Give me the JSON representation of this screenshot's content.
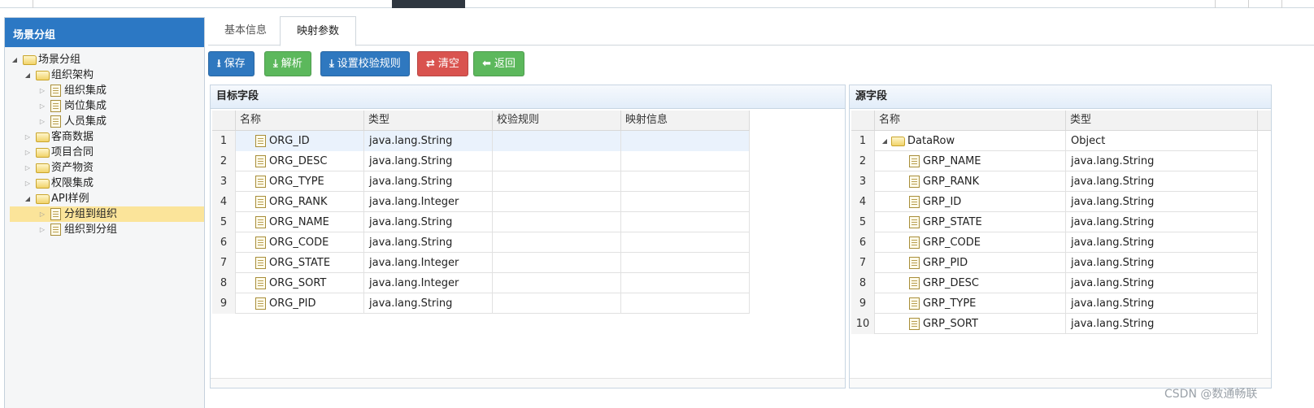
{
  "left_panel": {
    "title": "场景分组",
    "tree": [
      {
        "label": "场景分组",
        "type": "folder",
        "expanded": true,
        "level": 0
      },
      {
        "label": "组织架构",
        "type": "folder",
        "expanded": true,
        "level": 1
      },
      {
        "label": "组织集成",
        "type": "file",
        "level": 2
      },
      {
        "label": "岗位集成",
        "type": "file",
        "level": 2
      },
      {
        "label": "人员集成",
        "type": "file",
        "level": 2
      },
      {
        "label": "客商数据",
        "type": "folder",
        "expanded": false,
        "level": 1
      },
      {
        "label": "项目合同",
        "type": "folder",
        "expanded": false,
        "level": 1
      },
      {
        "label": "资产物资",
        "type": "folder",
        "expanded": false,
        "level": 1
      },
      {
        "label": "权限集成",
        "type": "folder",
        "expanded": false,
        "level": 1
      },
      {
        "label": "API样例",
        "type": "folder",
        "expanded": true,
        "level": 1
      },
      {
        "label": "分组到组织",
        "type": "file",
        "level": 2,
        "selected": true
      },
      {
        "label": "组织到分组",
        "type": "file",
        "level": 2
      }
    ]
  },
  "tabs": [
    {
      "label": "基本信息",
      "active": false
    },
    {
      "label": "映射参数",
      "active": true
    }
  ],
  "toolbar": {
    "buttons": [
      {
        "label": "保存",
        "icon": "download-icon",
        "color": "#2f78bf"
      },
      {
        "label": "解析",
        "icon": "parse-icon",
        "color": "#5cb85c"
      },
      {
        "label": "设置校验规则",
        "icon": "rules-icon",
        "color": "#2f78bf"
      },
      {
        "label": "清空",
        "icon": "shuffle-icon",
        "color": "#d9534f"
      },
      {
        "label": "返回",
        "icon": "arrow-left-icon",
        "color": "#5cb85c"
      }
    ]
  },
  "target": {
    "title": "目标字段",
    "columns": [
      "名称",
      "类型",
      "校验规则",
      "映射信息"
    ],
    "rows": [
      {
        "num": "1",
        "name": "ORG_ID",
        "type": "java.lang.String",
        "rule": "",
        "mapping": ""
      },
      {
        "num": "2",
        "name": "ORG_DESC",
        "type": "java.lang.String",
        "rule": "",
        "mapping": ""
      },
      {
        "num": "3",
        "name": "ORG_TYPE",
        "type": "java.lang.String",
        "rule": "",
        "mapping": ""
      },
      {
        "num": "4",
        "name": "ORG_RANK",
        "type": "java.lang.Integer",
        "rule": "",
        "mapping": ""
      },
      {
        "num": "5",
        "name": "ORG_NAME",
        "type": "java.lang.String",
        "rule": "",
        "mapping": ""
      },
      {
        "num": "6",
        "name": "ORG_CODE",
        "type": "java.lang.String",
        "rule": "",
        "mapping": ""
      },
      {
        "num": "7",
        "name": "ORG_STATE",
        "type": "java.lang.Integer",
        "rule": "",
        "mapping": ""
      },
      {
        "num": "8",
        "name": "ORG_SORT",
        "type": "java.lang.Integer",
        "rule": "",
        "mapping": ""
      },
      {
        "num": "9",
        "name": "ORG_PID",
        "type": "java.lang.String",
        "rule": "",
        "mapping": ""
      }
    ]
  },
  "source": {
    "title": "源字段",
    "columns": [
      "名称",
      "类型"
    ],
    "rows": [
      {
        "num": "1",
        "name": "DataRow",
        "type": "Object",
        "folder": true
      },
      {
        "num": "2",
        "name": "GRP_NAME",
        "type": "java.lang.String"
      },
      {
        "num": "3",
        "name": "GRP_RANK",
        "type": "java.lang.String"
      },
      {
        "num": "4",
        "name": "GRP_ID",
        "type": "java.lang.String"
      },
      {
        "num": "5",
        "name": "GRP_STATE",
        "type": "java.lang.String"
      },
      {
        "num": "6",
        "name": "GRP_CODE",
        "type": "java.lang.String"
      },
      {
        "num": "7",
        "name": "GRP_PID",
        "type": "java.lang.String"
      },
      {
        "num": "8",
        "name": "GRP_DESC",
        "type": "java.lang.String"
      },
      {
        "num": "9",
        "name": "GRP_TYPE",
        "type": "java.lang.String"
      },
      {
        "num": "10",
        "name": "GRP_SORT",
        "type": "java.lang.String"
      }
    ]
  },
  "watermark": "CSDN @数通畅联"
}
